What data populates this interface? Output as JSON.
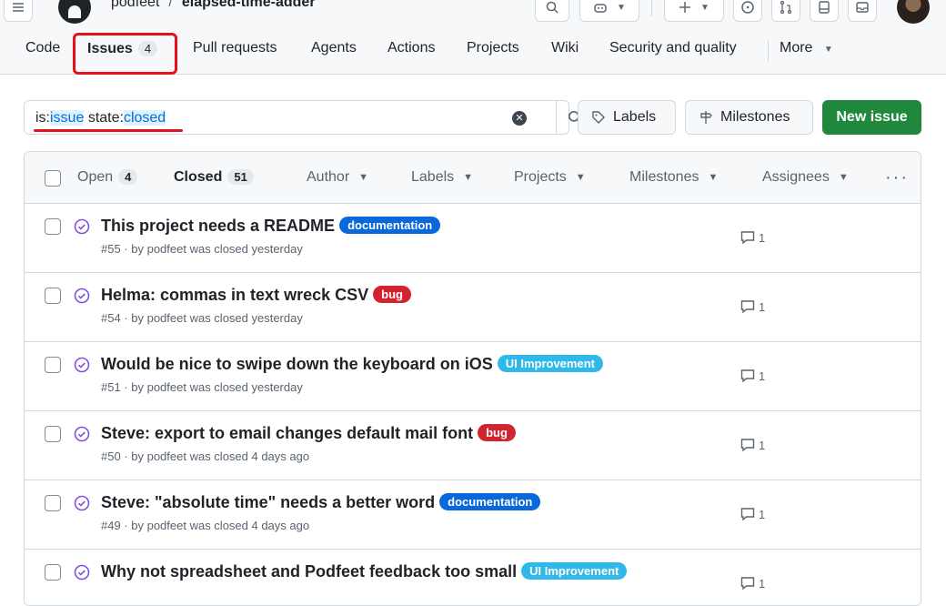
{
  "header": {
    "owner": "podfeet",
    "separator": "/",
    "repo": "elapsed-time-adder"
  },
  "repo_nav": {
    "items": [
      {
        "label": "Code"
      },
      {
        "label": "Issues",
        "count": "4"
      },
      {
        "label": "Pull requests"
      },
      {
        "label": "Agents"
      },
      {
        "label": "Actions"
      },
      {
        "label": "Projects"
      },
      {
        "label": "Wiki"
      },
      {
        "label": "Security and quality"
      },
      {
        "label": "More"
      }
    ]
  },
  "filter": {
    "is_key": "is:",
    "is_val": "issue",
    "space": " ",
    "state_key": "state:",
    "state_val": "closed",
    "clear": "✕"
  },
  "buttons": {
    "labels": "Labels",
    "milestones": "Milestones",
    "new_issue": "New issue"
  },
  "list_header": {
    "open_label": "Open",
    "open_count": "4",
    "closed_label": "Closed",
    "closed_count": "51",
    "filters": [
      "Author",
      "Labels",
      "Projects",
      "Milestones",
      "Assignees"
    ],
    "more": "···"
  },
  "colors": {
    "documentation": "#0969da",
    "bug": "#d1242f",
    "ui_improvement": "#2fb8e8",
    "closed_icon": "#8250df",
    "primary": "#1f883d",
    "highlight": "#e5101a"
  },
  "issues": [
    {
      "title": "This project needs a README",
      "label": "documentation",
      "meta": "#55 · by podfeet was closed yesterday",
      "comments": "1"
    },
    {
      "title": "Helma: commas in text wreck CSV",
      "label": "bug",
      "meta": "#54 · by podfeet was closed yesterday",
      "comments": "1"
    },
    {
      "title": "Would be nice to swipe down the keyboard on iOS",
      "label": "UI Improvement",
      "meta": "#51 · by podfeet was closed yesterday",
      "comments": "1"
    },
    {
      "title": "Steve: export to email changes default mail font",
      "label": "bug",
      "meta": "#50 · by podfeet was closed 4 days ago",
      "comments": "1"
    },
    {
      "title": "Steve: \"absolute time\" needs a better word",
      "label": "documentation",
      "meta": "#49 · by podfeet was closed 4 days ago",
      "comments": "1"
    },
    {
      "title": "Why not spreadsheet and Podfeet feedback too small",
      "label": "UI Improvement",
      "meta": "",
      "comments": "1"
    }
  ]
}
